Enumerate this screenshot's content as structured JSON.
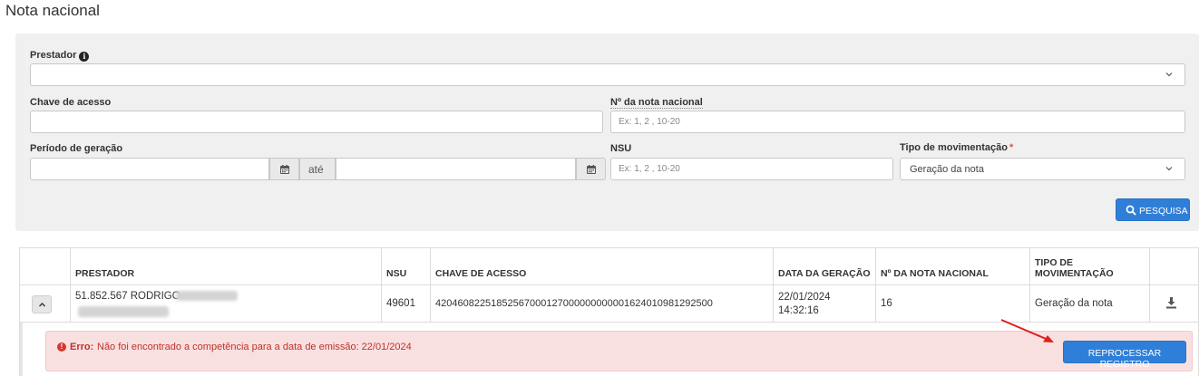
{
  "page": {
    "title": "Nota nacional"
  },
  "filters": {
    "prestador": {
      "label": "Prestador",
      "value": ""
    },
    "chave_acesso": {
      "label": "Chave de acesso",
      "value": ""
    },
    "numero_nota": {
      "label": "Nº da nota nacional",
      "placeholder": "Ex: 1, 2 , 10-20"
    },
    "periodo": {
      "label": "Período de geração",
      "start": "",
      "end": "",
      "separator": "até"
    },
    "nsu": {
      "label": "NSU",
      "placeholder": "Ex: 1, 2 , 10-20"
    },
    "tipo_movimentacao": {
      "label": "Tipo de movimentação",
      "required_mark": "*",
      "value": "Geração da nota"
    },
    "search_button": "PESQUISA"
  },
  "table": {
    "headers": [
      "",
      "PRESTADOR",
      "NSU",
      "CHAVE DE ACESSO",
      "DATA DA GERAÇÃO",
      "Nº DA NOTA NACIONAL",
      "TIPO DE MOVIMENTAÇÃO",
      ""
    ],
    "rows": [
      {
        "prestador": "51.852.567 RODRIGO",
        "nsu": "49601",
        "chave": "42046082251852567000127000000000001624010981292500",
        "data_date": "22/01/2024",
        "data_time": "14:32:16",
        "numero": "16",
        "tipo": "Geração da nota"
      }
    ]
  },
  "error": {
    "strong": "Erro:",
    "message": "Não foi encontrado a competência para a data de emissão: 22/01/2024",
    "button": "REPROCESSAR REGISTRO"
  },
  "colors": {
    "primary": "#2f7fd8",
    "error_bg": "#f9e0e0",
    "error_text": "#c0302a",
    "panel_bg": "#f0f0f0",
    "annotation_arrow": "#e0201c"
  },
  "icons": [
    "info-icon",
    "chevron-down-icon",
    "calendar-icon",
    "search-icon",
    "chevron-up-icon",
    "download-icon",
    "error-icon",
    "annotation-arrow-icon"
  ]
}
